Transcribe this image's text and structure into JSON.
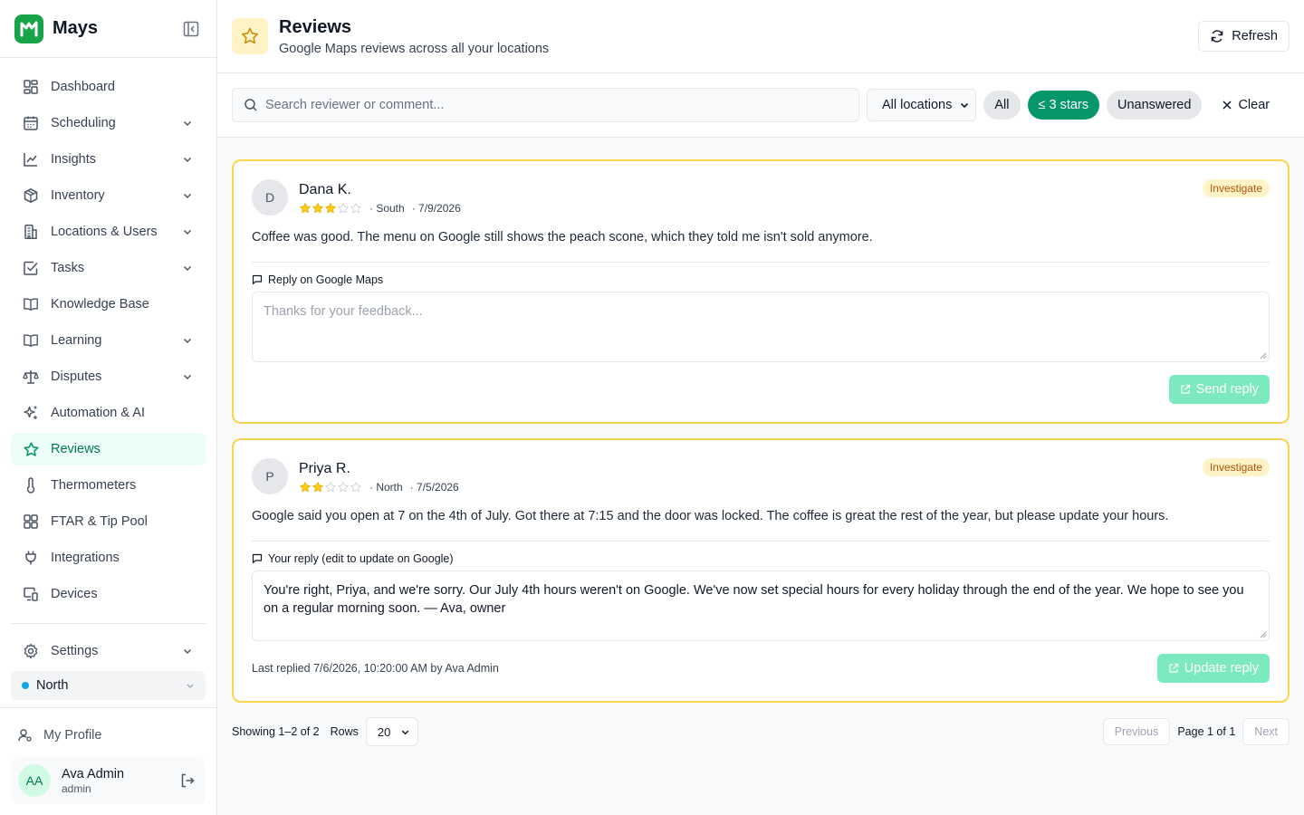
{
  "brand": {
    "name": "Mays",
    "logo_icon": "mays-logo-icon",
    "accent": "#16a34a"
  },
  "sidebar": {
    "items": [
      {
        "label": "Dashboard",
        "icon": "dashboard-icon",
        "expandable": false
      },
      {
        "label": "Scheduling",
        "icon": "calendar-icon",
        "expandable": true
      },
      {
        "label": "Insights",
        "icon": "chart-icon",
        "expandable": true
      },
      {
        "label": "Inventory",
        "icon": "box-icon",
        "expandable": true
      },
      {
        "label": "Locations & Users",
        "icon": "building-icon",
        "expandable": true
      },
      {
        "label": "Tasks",
        "icon": "checkbox-icon",
        "expandable": true
      },
      {
        "label": "Knowledge Base",
        "icon": "book-icon",
        "expandable": false
      },
      {
        "label": "Learning",
        "icon": "book-open-icon",
        "expandable": true
      },
      {
        "label": "Disputes",
        "icon": "scale-icon",
        "expandable": true
      },
      {
        "label": "Automation & AI",
        "icon": "sparkles-icon",
        "expandable": false
      },
      {
        "label": "Reviews",
        "icon": "star-icon",
        "expandable": false,
        "active": true
      },
      {
        "label": "Thermometers",
        "icon": "thermometer-icon",
        "expandable": false
      },
      {
        "label": "FTAR & Tip Pool",
        "icon": "grid-icon",
        "expandable": false
      },
      {
        "label": "Integrations",
        "icon": "plug-icon",
        "expandable": false
      },
      {
        "label": "Devices",
        "icon": "devices-icon",
        "expandable": false
      }
    ],
    "settings_label": "Settings",
    "location": {
      "label": "North",
      "dot_color": "#0ea5e9"
    },
    "profile_label": "My Profile",
    "user": {
      "initials": "AA",
      "name": "Ava Admin",
      "role": "admin"
    }
  },
  "header": {
    "title": "Reviews",
    "subtitle": "Google Maps reviews across all your locations",
    "refresh_label": "Refresh"
  },
  "filters": {
    "search_placeholder": "Search reviewer or comment...",
    "location_value": "All locations",
    "chips": {
      "all": "All",
      "low_stars": "≤ 3 stars",
      "unanswered": "Unanswered"
    },
    "clear_label": "Clear"
  },
  "reviews": [
    {
      "initial": "D",
      "name": "Dana K.",
      "rating": 3,
      "location": "· South",
      "date": "· 7/9/2026",
      "badge": "Investigate",
      "text": "Coffee was good. The menu on Google still shows the peach scone, which they told me isn't sold anymore.",
      "reply_label": "Reply on Google Maps",
      "reply_placeholder": "Thanks for your feedback...",
      "reply_text": "",
      "last_replied": "",
      "button_label": "Send reply"
    },
    {
      "initial": "P",
      "name": "Priya R.",
      "rating": 2,
      "location": "· North",
      "date": "· 7/5/2026",
      "badge": "Investigate",
      "text": "Google said you open at 7 on the 4th of July. Got there at 7:15 and the door was locked. The coffee is great the rest of the year, but please update your hours.",
      "reply_label": "Your reply (edit to update on Google)",
      "reply_placeholder": "",
      "reply_text": "You're right, Priya, and we're sorry. Our July 4th hours weren't on Google. We've now set special hours for every holiday through the end of the year. We hope to see you on a regular morning soon. — Ava, owner",
      "last_replied": "Last replied 7/6/2026, 10:20:00 AM by Ava Admin",
      "button_label": "Update reply"
    }
  ],
  "pagination": {
    "showing": "Showing 1–2 of 2",
    "rows_label": "Rows",
    "rows_value": "20",
    "previous": "Previous",
    "page_info": "Page 1 of 1",
    "next": "Next"
  },
  "colors": {
    "star": "#facc15",
    "card_border": "#fcd34d",
    "active_green": "#059669"
  }
}
